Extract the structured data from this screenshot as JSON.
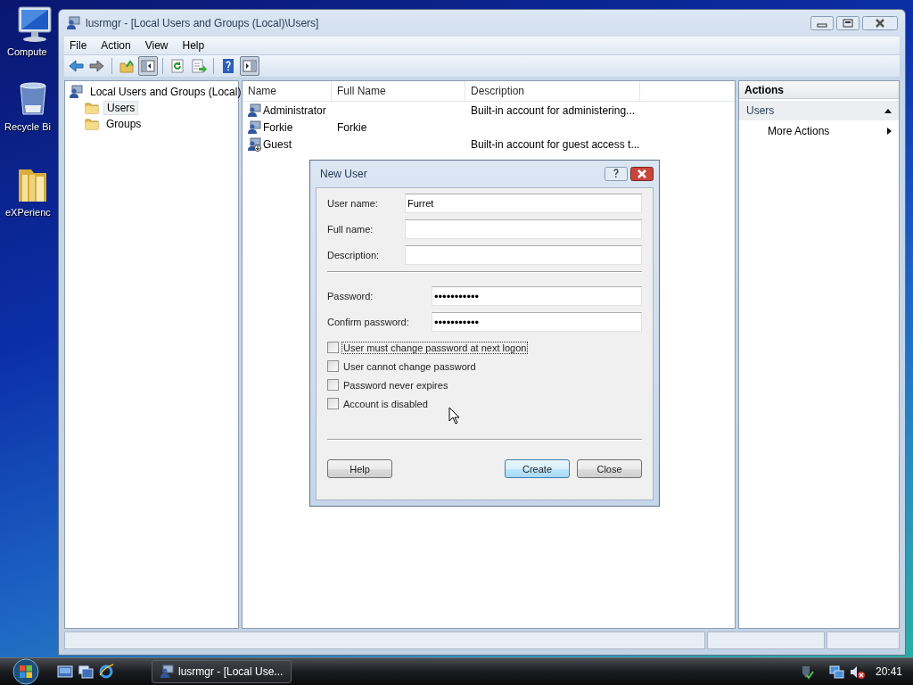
{
  "desktop_icons": [
    {
      "kind": "computer",
      "label": "Compute"
    },
    {
      "kind": "recycle",
      "label": "Recycle Bi"
    },
    {
      "kind": "folder",
      "label": "eXPerienc"
    }
  ],
  "window": {
    "title": "lusrmgr - [Local Users and Groups (Local)\\Users]"
  },
  "menu": [
    "File",
    "Action",
    "View",
    "Help"
  ],
  "toolbar": [
    {
      "kind": "back",
      "pressed": false
    },
    {
      "kind": "forward",
      "pressed": false
    },
    {
      "kind": "sep"
    },
    {
      "kind": "up",
      "pressed": false
    },
    {
      "kind": "tree",
      "pressed": true
    },
    {
      "kind": "sep"
    },
    {
      "kind": "refresh",
      "pressed": false
    },
    {
      "kind": "export",
      "pressed": false
    },
    {
      "kind": "sep"
    },
    {
      "kind": "help",
      "pressed": false
    },
    {
      "kind": "actionpane",
      "pressed": true
    }
  ],
  "tree": {
    "label": "Local Users and Groups (Local)",
    "children": [
      {
        "label": "Users",
        "selected": true
      },
      {
        "label": "Groups",
        "selected": false
      }
    ]
  },
  "list": {
    "columns": [
      "Name",
      "Full Name",
      "Description"
    ],
    "rows": [
      {
        "kind": "user",
        "name": "Administrator",
        "description": "Built-in account for administering..."
      },
      {
        "kind": "user",
        "name": "Forkie",
        "full_name": "Forkie"
      },
      {
        "kind": "disabled_user",
        "name": "Guest",
        "description": "Built-in account for guest access t..."
      }
    ]
  },
  "actions": {
    "title": "Actions",
    "section": "Users",
    "expanded": true,
    "items": [
      "More Actions"
    ]
  },
  "dialog": {
    "title": "New User",
    "fields": [
      {
        "label": "User name:",
        "value": "Furret"
      },
      {
        "label": "Full name:"
      },
      {
        "label": "Description:"
      }
    ],
    "password_fields": [
      {
        "label": "Password:",
        "value": "•••••••••••"
      },
      {
        "label": "Confirm password:",
        "value": "•••••••••••"
      }
    ],
    "checkboxes": [
      {
        "label": "User must change password at next logon",
        "checked": false,
        "focused": true
      },
      {
        "label": "User cannot change password",
        "checked": false,
        "focused": false
      },
      {
        "label": "Password never expires",
        "checked": false,
        "focused": false
      },
      {
        "label": "Account is disabled",
        "checked": false,
        "focused": false
      }
    ],
    "buttons": [
      {
        "label": "Help",
        "default": false
      },
      {
        "label": "Create",
        "default": true
      },
      {
        "label": "Close",
        "default": false
      }
    ]
  },
  "taskbar": {
    "quick_launch": [
      {
        "kind": "desktop"
      },
      {
        "kind": "switch"
      },
      {
        "kind": "browser"
      }
    ],
    "tasks": [
      {
        "label": "lusrmgr - [Local Use..."
      }
    ],
    "tray": [
      {
        "kind": "security"
      },
      {
        "kind": "network"
      },
      {
        "kind": "sound_muted"
      }
    ],
    "clock": "20:41"
  }
}
